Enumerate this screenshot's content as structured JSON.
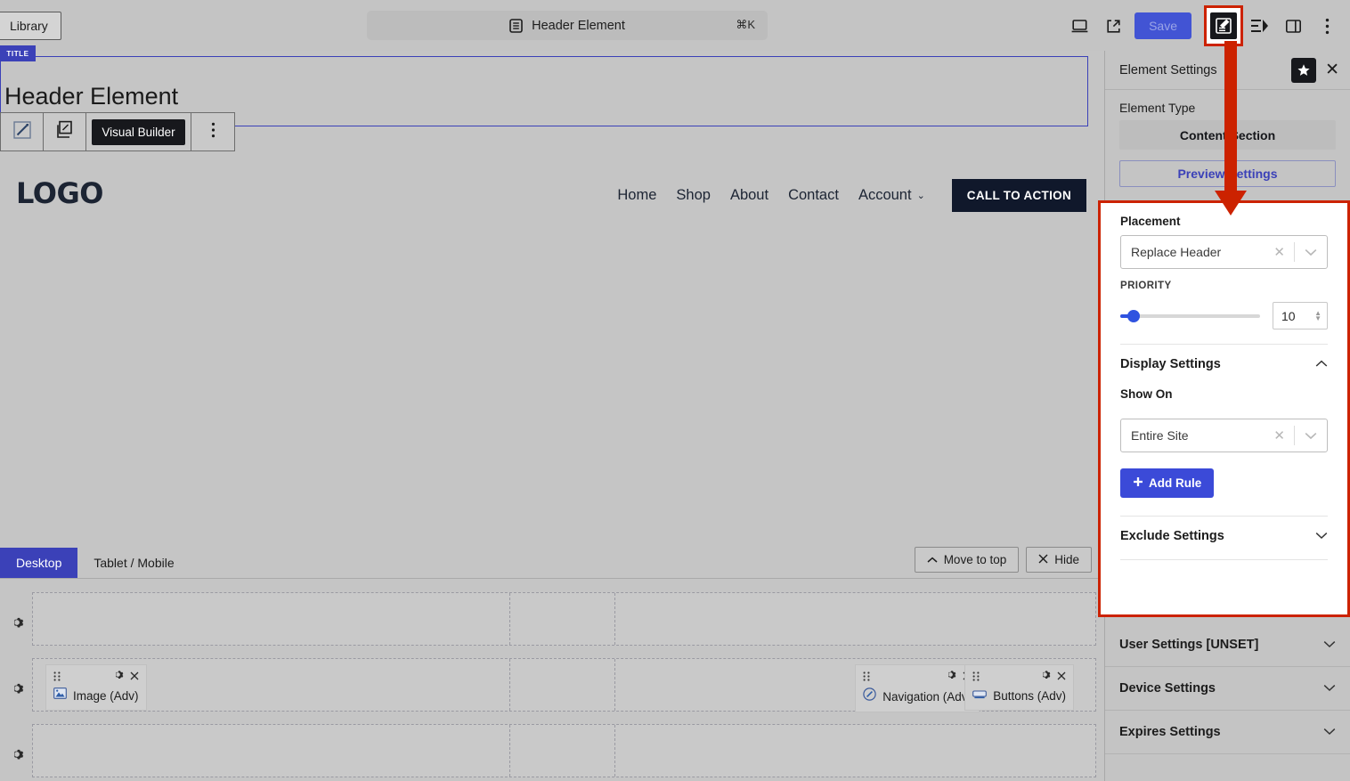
{
  "topbar": {
    "library_label": "Library",
    "command_title": "Header Element",
    "command_shortcut": "⌘K",
    "doc_icon": "document-icon",
    "desktop_icon": "desktop-preview-icon",
    "external_icon": "open-external-icon",
    "save_label": "Save",
    "highlighted_icon": "edit-element-icon",
    "structure_icon": "structure-icon",
    "panel_icon": "toggle-sidebar-icon",
    "more_icon": "more-options-icon"
  },
  "canvas": {
    "title_tab": "TITLE",
    "doc_title": "Header Element",
    "toolbar": {
      "edit_icon": "pencil-square-icon",
      "duplicate_icon": "duplicate-icon",
      "visual_builder_label": "Visual Builder",
      "more_icon": "more-vertical-icon"
    },
    "site_preview": {
      "logo": "LOGO",
      "nav": [
        {
          "label": "Home",
          "has_caret": false
        },
        {
          "label": "Shop",
          "has_caret": false
        },
        {
          "label": "About",
          "has_caret": false
        },
        {
          "label": "Contact",
          "has_caret": false
        },
        {
          "label": "Account",
          "has_caret": true
        }
      ],
      "cta_label": "CALL TO ACTION"
    }
  },
  "builder": {
    "tabs": [
      {
        "label": "Desktop",
        "active": true
      },
      {
        "label": "Tablet / Mobile",
        "active": false
      }
    ],
    "actions": [
      {
        "label": "Move to top",
        "icon": "chevron-up-icon"
      },
      {
        "label": "Hide",
        "icon": "close-icon"
      }
    ],
    "rows": [
      {
        "gear_icon": "row-settings-gear-icon",
        "elements": []
      },
      {
        "gear_icon": "row-settings-gear-icon",
        "elements": [
          {
            "label": "Image (Adv)",
            "icon": "image-icon",
            "column": 1,
            "align": "left"
          },
          {
            "label": "Navigation (Adv)",
            "icon": "navigation-icon",
            "column": 3,
            "align": "right-1"
          },
          {
            "label": "Buttons (Adv)",
            "icon": "buttons-icon",
            "column": 3,
            "align": "right-2"
          }
        ]
      },
      {
        "gear_icon": "row-settings-gear-icon",
        "elements": []
      }
    ],
    "element_controls": {
      "drag_icon": "drag-handle-icon",
      "gear_icon": "gear-icon",
      "close_icon": "close-icon"
    }
  },
  "right_panel": {
    "header": {
      "title": "Element Settings",
      "star_icon": "star-icon",
      "close_icon": "close-icon"
    },
    "element_type_label": "Element Type",
    "element_type_value": "Content Section",
    "preview_settings_label": "Preview Settings",
    "placement": {
      "label": "Placement",
      "value": "Replace Header",
      "clear_icon": "clear-icon",
      "caret_icon": "chevron-down-icon"
    },
    "priority": {
      "label": "PRIORITY",
      "value": "10",
      "slider_percent": 5
    },
    "display_settings": {
      "label": "Display Settings",
      "caret_icon": "chevron-up-icon",
      "show_on_label": "Show On",
      "show_on_value": "Entire Site",
      "clear_icon": "clear-icon",
      "select_caret_icon": "chevron-down-icon",
      "add_rule_label": "Add Rule",
      "add_rule_icon": "plus-icon"
    },
    "exclude_settings": {
      "label": "Exclude Settings",
      "caret_icon": "chevron-down-icon"
    },
    "collapsed_sections": [
      {
        "label": "User Settings [UNSET]",
        "caret_icon": "chevron-down-icon"
      },
      {
        "label": "Device Settings",
        "caret_icon": "chevron-down-icon"
      },
      {
        "label": "Expires Settings",
        "caret_icon": "chevron-down-icon"
      }
    ]
  },
  "colors": {
    "accent_blue": "#3b41b8",
    "button_blue": "#3b4ad8",
    "highlight_red": "#cc2200",
    "dark": "#17181c",
    "panel_bg": "#c4c4c4"
  }
}
